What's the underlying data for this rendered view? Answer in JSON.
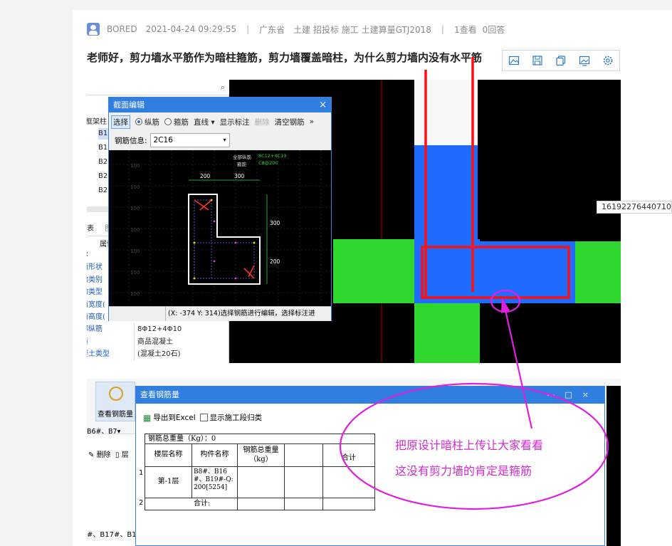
{
  "post": {
    "author": "BORED",
    "date": "2021-04-24 09:29:55",
    "province": "广东省",
    "tags": "土建 招投标 施工 土建算量GTJ2018",
    "views": "1查看",
    "answers": "0回答",
    "title": "老师好，剪力墙水平筋作为暗柱箍筋，剪力墙覆盖暗柱，为什么剪力墙内没有水平筋"
  },
  "image_toolbar": {
    "icons": [
      "image-add-icon",
      "save-icon",
      "copy-icon",
      "image-view-icon",
      "settings-icon"
    ]
  },
  "left_panel": {
    "tree_head": "框架柱",
    "tree_items": [
      "B1",
      "B1",
      "B2",
      "B2",
      "B2"
    ],
    "tabs": [
      "表",
      "图"
    ],
    "prop_head": "属性名",
    "props": [
      {
        "k": "尔",
        "v": ""
      },
      {
        "k": "面形状",
        "v": ""
      },
      {
        "k": "构类别",
        "v": ""
      },
      {
        "k": "构类型",
        "v": ""
      },
      {
        "k": "面宽度(",
        "v": ""
      },
      {
        "k": "面高度(",
        "v": ""
      },
      {
        "k": "部纵筋",
        "v": "8Φ12+4Φ10"
      },
      {
        "k": "质",
        "v": "商品混凝土"
      },
      {
        "k": "凝土类型",
        "v": "(混凝土20石)"
      }
    ]
  },
  "section_editor": {
    "title": "截面编辑",
    "close": "×",
    "tools": {
      "select": "选择",
      "longitudinal": "纵筋",
      "stirrup": "箍筋",
      "line": "直线",
      "show_label": "显示标注",
      "delete": "删除",
      "clear": "清空钢筋",
      "more": "»"
    },
    "rebar_info_label": "钢筋信息:",
    "rebar_info_value": "2C16",
    "legend_all": "全部纵筋",
    "legend_all_value": "8C12+4C10",
    "legend_stirrup": "箍筋",
    "legend_stirrup_value": "C8@200",
    "dims": {
      "top_left": "200",
      "top_right": "300",
      "right_upper": "300",
      "right_lower": "200"
    },
    "status": "(X: -374 Y: 314)选择钢筋进行编辑，选择标注进"
  },
  "tooltip": "16192276440710",
  "ribbon": {
    "view_rebar": "查看钢筋量",
    "selection": "B6#、B7",
    "delete": "删除",
    "layer": "层",
    "left_foot": [
      "#、B17#、B1",
      "#、B17#、B1"
    ]
  },
  "rebar_window": {
    "title": "查看钢筋量",
    "controls": [
      "—",
      "□",
      "×"
    ],
    "export": "导出到Excel",
    "show_segment": "显示施工段归类",
    "total": "钢筋总重量（Kg）：0",
    "headers": {
      "floor": "楼层名称",
      "member": "构件名称",
      "weight": "钢筋总重量\n（kg）",
      "sum": "合计"
    },
    "row_index_1": "1",
    "row_index_2": "2",
    "floor": "第-1层",
    "member": "B8#、B16#、B19#-Q:200[5254]",
    "subtotal": "合计:"
  },
  "annotation": {
    "line1": "把原设计暗柱上传让大家看看",
    "line2": "这没有剪力墙的肯定是箍筋"
  },
  "colors": {
    "accent": "#2f7ee0",
    "annotation": "#e020e0",
    "red": "#ff1010",
    "blue": "#1f6bff",
    "green": "#2fd82f"
  }
}
